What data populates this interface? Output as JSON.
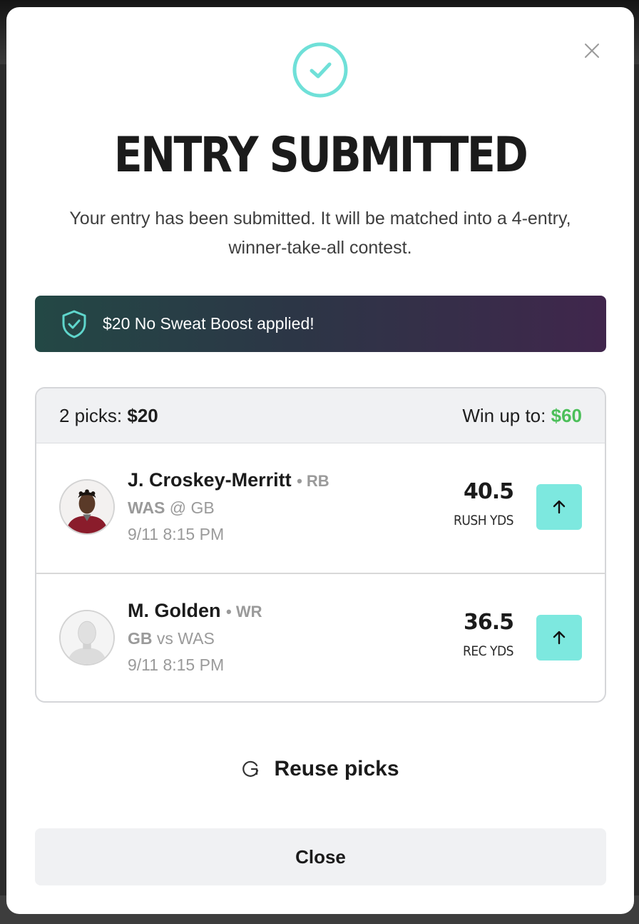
{
  "modal": {
    "title": "ENTRY SUBMITTED",
    "subtitle": "Your entry has been submitted. It will be matched into a 4-entry, winner-take-all contest."
  },
  "boost": {
    "text": "$20 No Sweat Boost applied!"
  },
  "entry": {
    "picks_label": "2 picks:",
    "picks_amount": "$20",
    "win_label": "Win up to:",
    "win_amount": "$60",
    "picks": [
      {
        "name": "J. Croskey-Merritt",
        "position": "• RB",
        "team": "WAS",
        "matchup": "@ GB",
        "time": "9/11 8:15 PM",
        "line": "40.5",
        "stat": "RUSH YDS",
        "direction_icon": "arrow-up-icon"
      },
      {
        "name": "M. Golden",
        "position": "• WR",
        "team": "GB",
        "matchup": "vs WAS",
        "time": "9/11 8:15 PM",
        "line": "36.5",
        "stat": "REC YDS",
        "direction_icon": "arrow-up-icon"
      }
    ]
  },
  "actions": {
    "reuse_label": "Reuse picks",
    "close_label": "Close"
  },
  "colors": {
    "accent": "#7de8df",
    "win": "#4cbf5a",
    "check": "#6fe0d8"
  }
}
